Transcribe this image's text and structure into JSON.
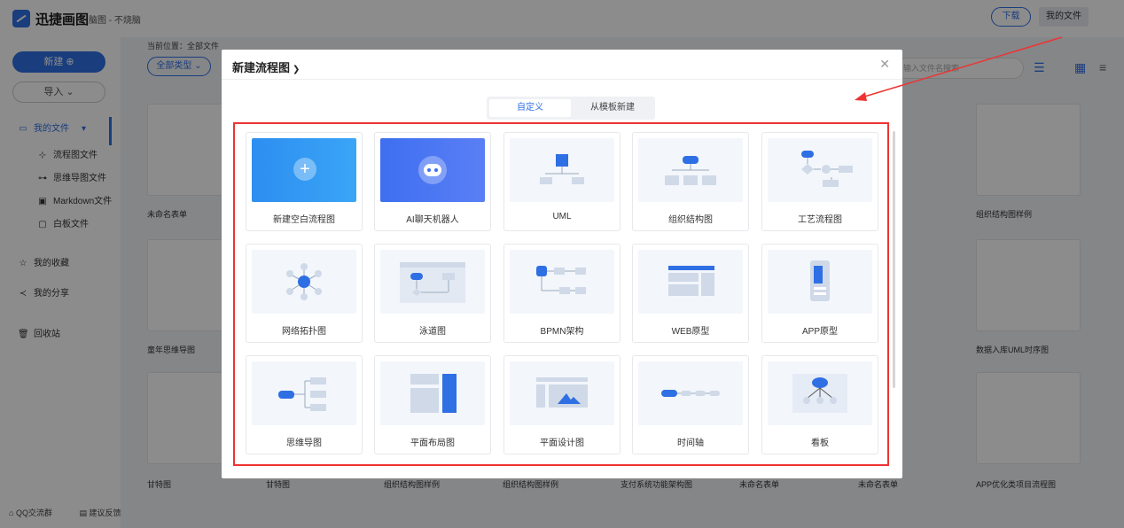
{
  "app": {
    "title": "迅捷画图",
    "subtitle": "脑图 - 不烧脑"
  },
  "topbar": {
    "download_label": "下载",
    "myfiles_label": "我的文件"
  },
  "sidebar": {
    "new_label": "新建 ⊕",
    "import_label": "导入 ⌄",
    "items": [
      {
        "label": "我的文件",
        "icon": "folder-icon"
      },
      {
        "label": "流程图文件",
        "icon": "flowchart-icon"
      },
      {
        "label": "思维导图文件",
        "icon": "mindmap-icon"
      },
      {
        "label": "Markdown文件",
        "icon": "markdown-icon"
      },
      {
        "label": "白板文件",
        "icon": "whiteboard-icon"
      },
      {
        "label": "我的收藏",
        "icon": "star-icon"
      },
      {
        "label": "我的分享",
        "icon": "share-icon"
      },
      {
        "label": "回收站",
        "icon": "trash-icon"
      }
    ],
    "footer": {
      "qq": "QQ交流群",
      "feedback": "建议反馈"
    }
  },
  "main": {
    "crumb": "当前位置：全部文件",
    "filter_label": "全部类型 ⌄",
    "search_placeholder": "输入文件名搜索",
    "cards": [
      "未命名表单",
      "组织结构图样例",
      "童年思维导图",
      "数据入库UML时序图",
      "甘特图",
      "甘特图",
      "组织结构图样例",
      "组织结构图样例",
      "支付系统功能架构图",
      "未命名表单",
      "未命名表单",
      "APP优化类项目流程图"
    ]
  },
  "modal": {
    "title": "新建流程图",
    "tabs": [
      "自定义",
      "从模板新建"
    ],
    "templates": [
      "新建空白流程图",
      "AI聊天机器人",
      "UML",
      "组织结构图",
      "工艺流程图",
      "网络拓扑图",
      "泳道图",
      "BPMN架构",
      "WEB原型",
      "APP原型",
      "思维导图",
      "平面布局图",
      "平面设计图",
      "时间轴",
      "看板"
    ]
  },
  "colors": {
    "accent": "#2f6fe4",
    "highlight": "#e33333"
  }
}
